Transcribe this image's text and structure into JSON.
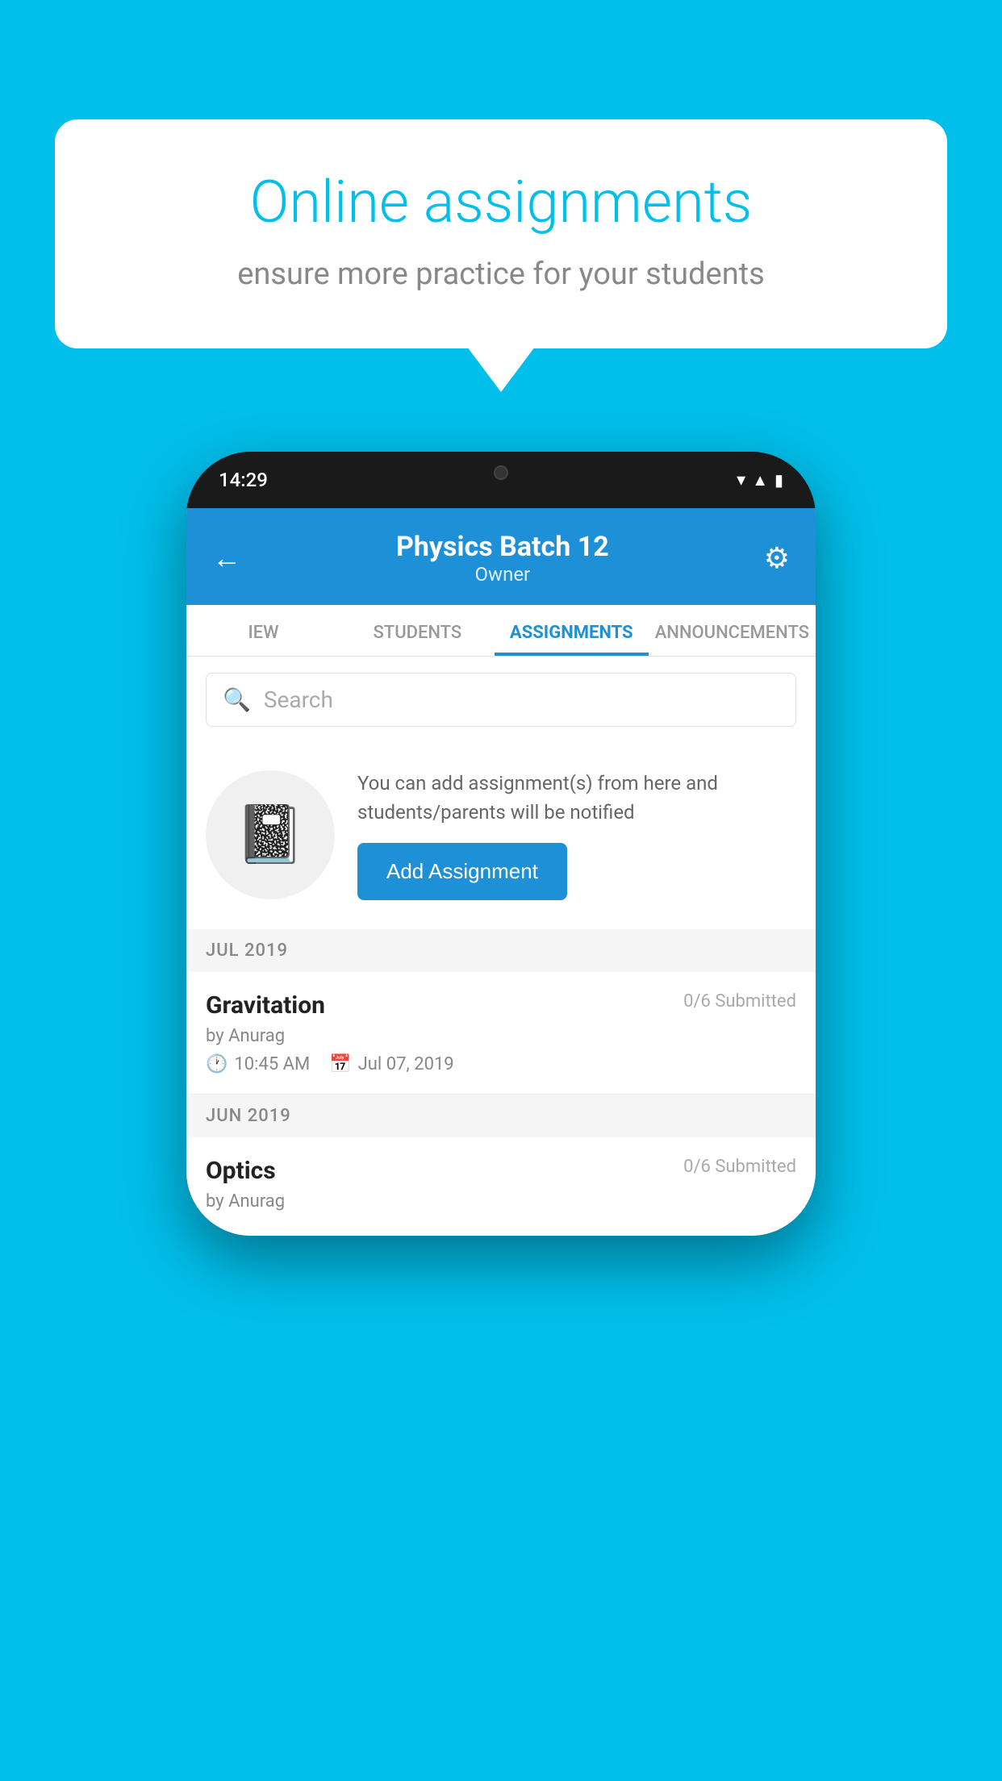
{
  "background_color": "#00BFEA",
  "speech_bubble": {
    "title": "Online assignments",
    "subtitle": "ensure more practice for your students"
  },
  "phone": {
    "status_bar": {
      "time": "14:29",
      "icons": [
        "wifi",
        "signal",
        "battery"
      ]
    },
    "header": {
      "title": "Physics Batch 12",
      "subtitle": "Owner",
      "back_label": "←",
      "gear_label": "⚙"
    },
    "tabs": [
      {
        "label": "IEW",
        "active": false
      },
      {
        "label": "STUDENTS",
        "active": false
      },
      {
        "label": "ASSIGNMENTS",
        "active": true
      },
      {
        "label": "ANNOUNCEMENTS",
        "active": false
      }
    ],
    "search": {
      "placeholder": "Search"
    },
    "promo": {
      "description": "You can add assignment(s) from here and students/parents will be notified",
      "button_label": "Add Assignment"
    },
    "sections": [
      {
        "month_label": "JUL 2019",
        "assignments": [
          {
            "name": "Gravitation",
            "submitted": "0/6 Submitted",
            "by": "by Anurag",
            "time": "10:45 AM",
            "date": "Jul 07, 2019"
          }
        ]
      },
      {
        "month_label": "JUN 2019",
        "assignments": [
          {
            "name": "Optics",
            "submitted": "0/6 Submitted",
            "by": "by Anurag",
            "time": "",
            "date": ""
          }
        ]
      }
    ]
  }
}
